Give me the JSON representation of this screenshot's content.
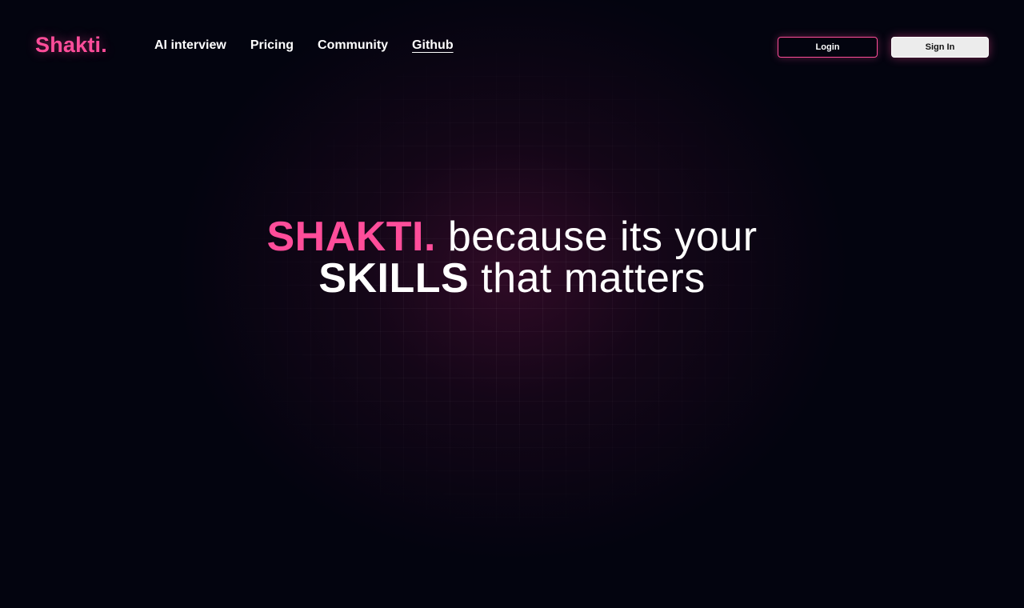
{
  "brand": {
    "logo_text": "Shakti.",
    "accent_color": "#ff4d9a"
  },
  "nav": {
    "links": [
      {
        "label": "AI interview"
      },
      {
        "label": "Pricing"
      },
      {
        "label": "Community"
      },
      {
        "label": "Github"
      }
    ],
    "login_label": "Login",
    "signin_label": "Sign In"
  },
  "hero": {
    "brand_word": "SHAKTI.",
    "line1_rest": "because its your",
    "strong_word": "SKILLS",
    "line2_rest": "that matters"
  },
  "colors": {
    "background": "#03040f",
    "text": "#ffffff"
  }
}
